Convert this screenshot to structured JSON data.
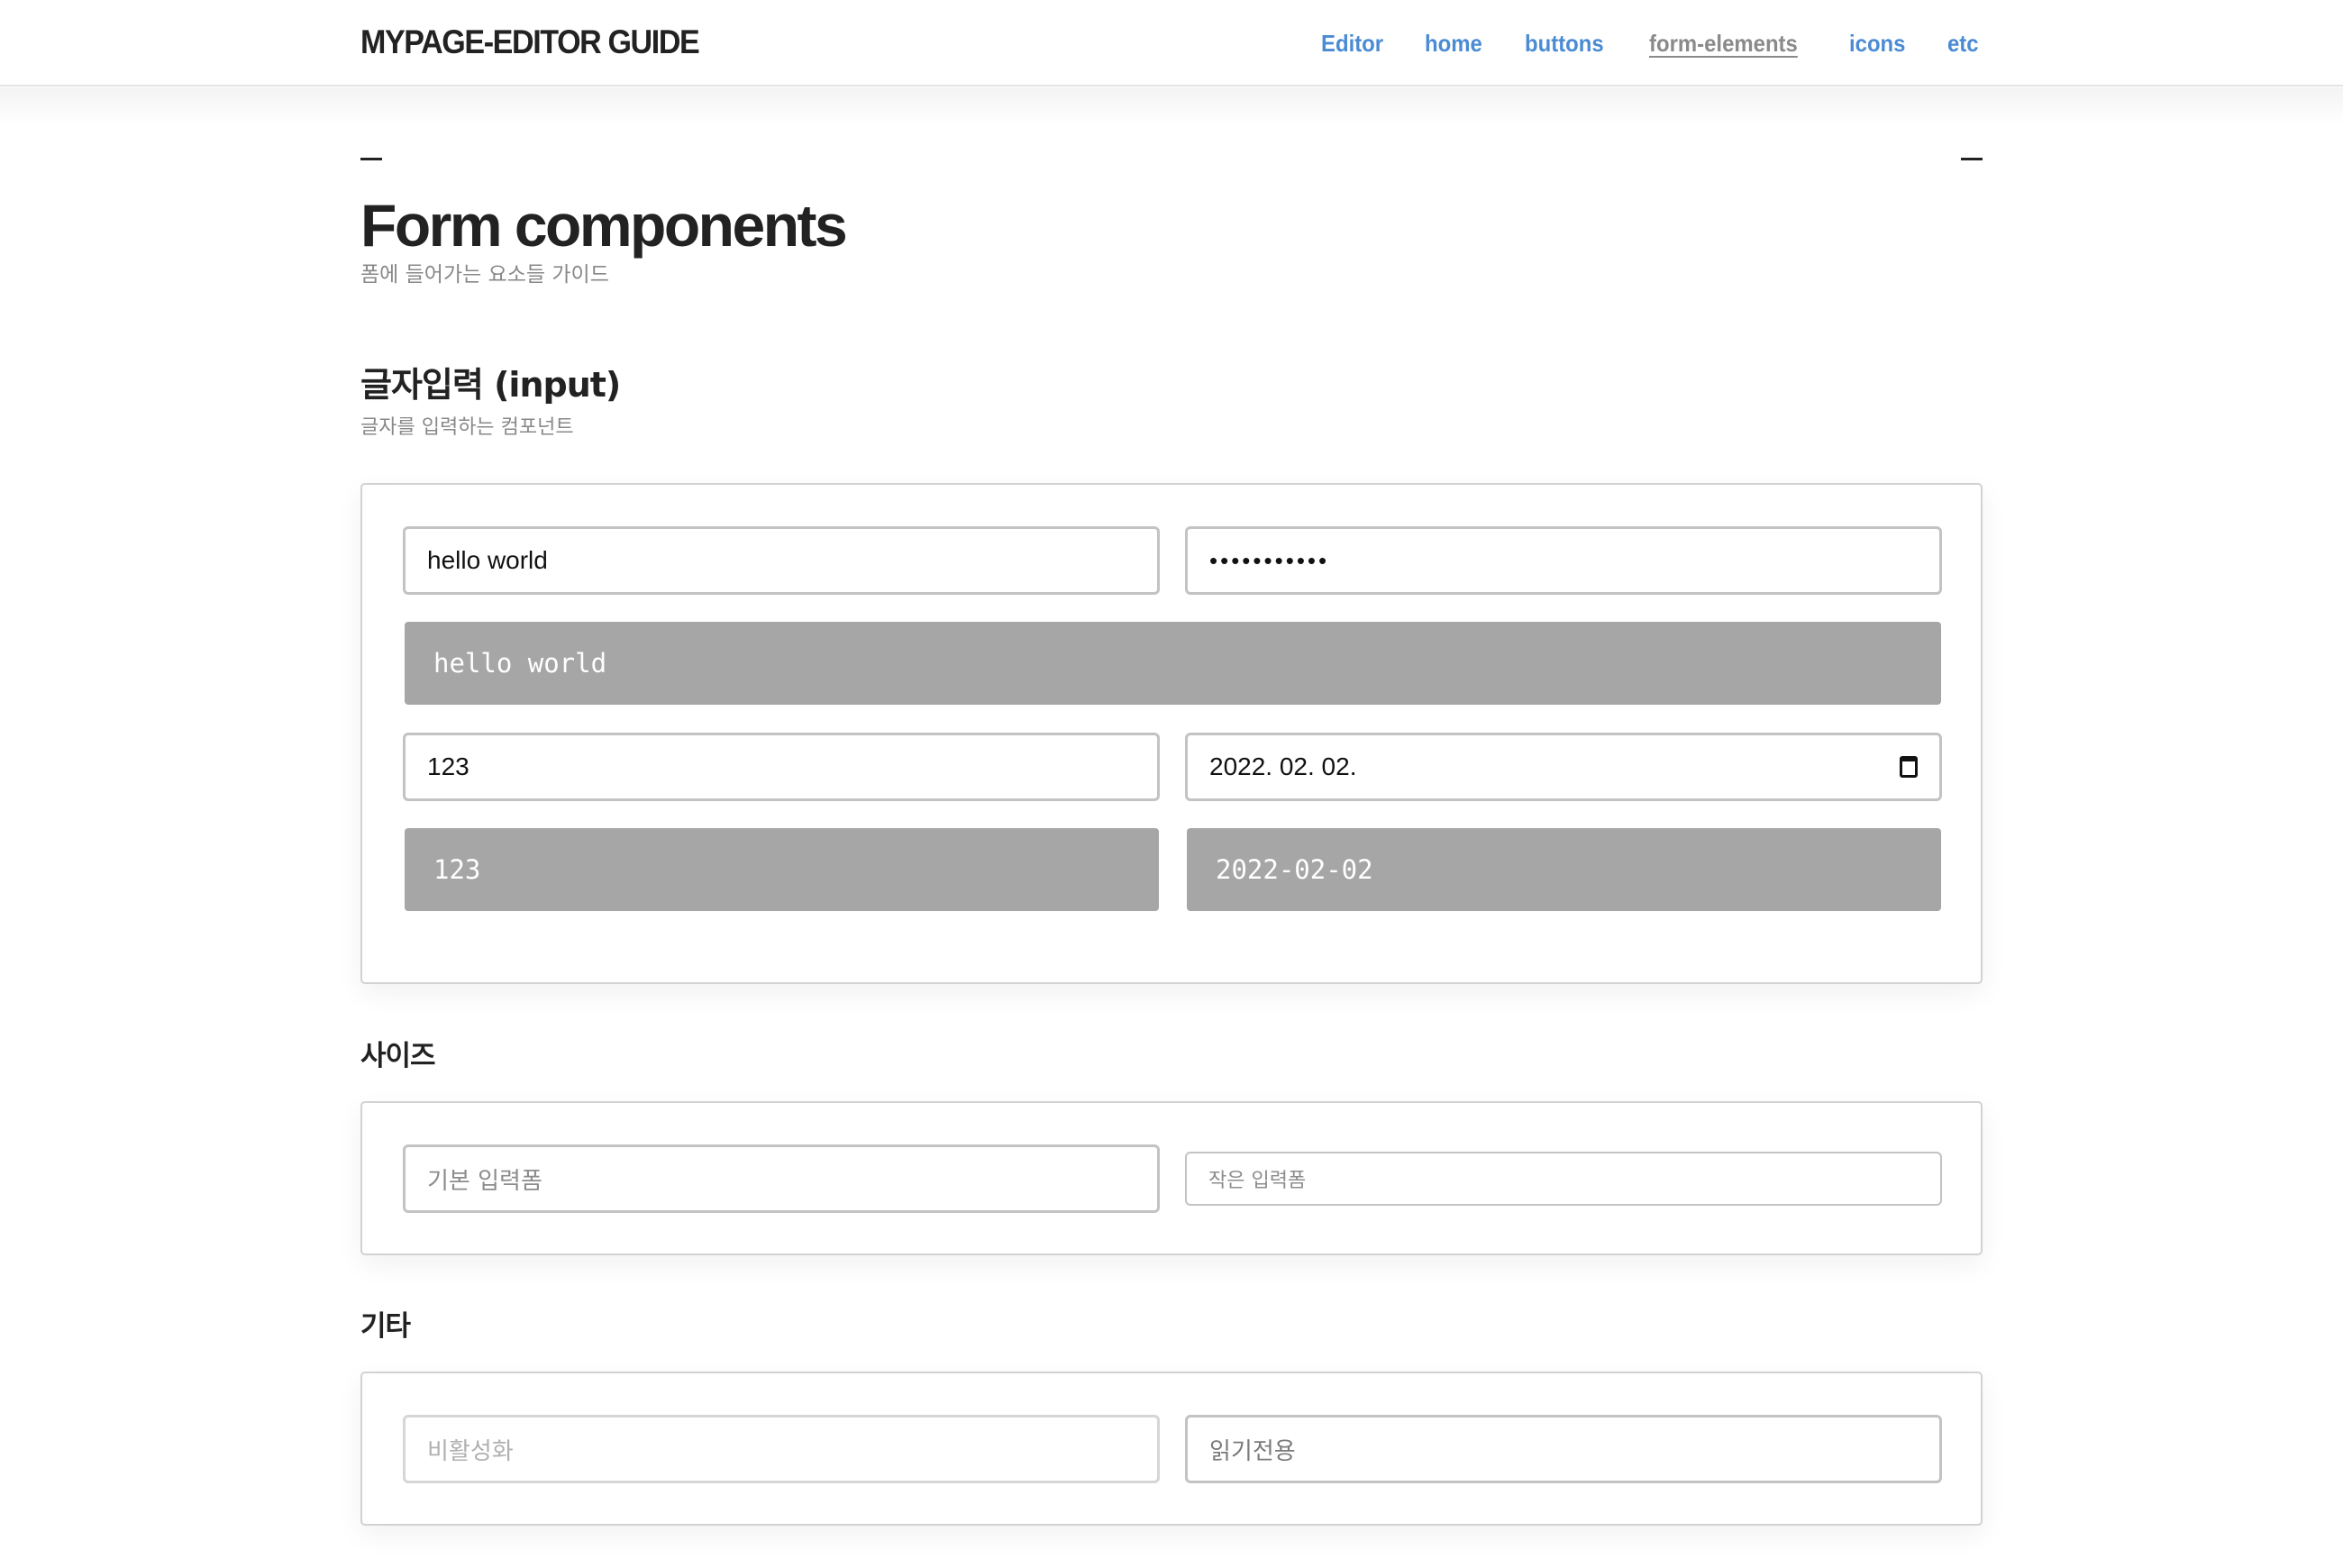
{
  "header": {
    "logo": "MYPAGE-EDITOR GUIDE",
    "nav": [
      {
        "label": "Editor",
        "active": false
      },
      {
        "label": "home",
        "active": false
      },
      {
        "label": "buttons",
        "active": false
      },
      {
        "label": "form-elements",
        "active": true
      },
      {
        "label": "icons",
        "active": false
      },
      {
        "label": "etc",
        "active": false
      }
    ],
    "link_color": "#4a8bd4",
    "active_color": "#8a8a8a"
  },
  "page": {
    "title": "Form components",
    "subtitle": "폼에 들어가는 요소들 가이드"
  },
  "sections": {
    "input": {
      "title": "글자입력 (input)",
      "subtitle": "글자를 입력하는 컴포넌트",
      "text_input_value": "hello world",
      "password_input_value": "•••••••••••",
      "text_output": "hello world",
      "number_input_value": "123",
      "date_input_display": "2022. 02. 02.",
      "date_icon": "calendar-icon",
      "number_output": "123",
      "date_output": "2022-02-02"
    },
    "size": {
      "title": "사이즈",
      "default_placeholder": "기본 입력폼",
      "small_placeholder": "작은 입력폼"
    },
    "etc": {
      "title": "기타",
      "disabled_placeholder": "비활성화",
      "readonly_value": "읽기전용"
    }
  },
  "colors": {
    "output_bg": "#a6a6a6",
    "field_border": "#c3c3c3"
  }
}
